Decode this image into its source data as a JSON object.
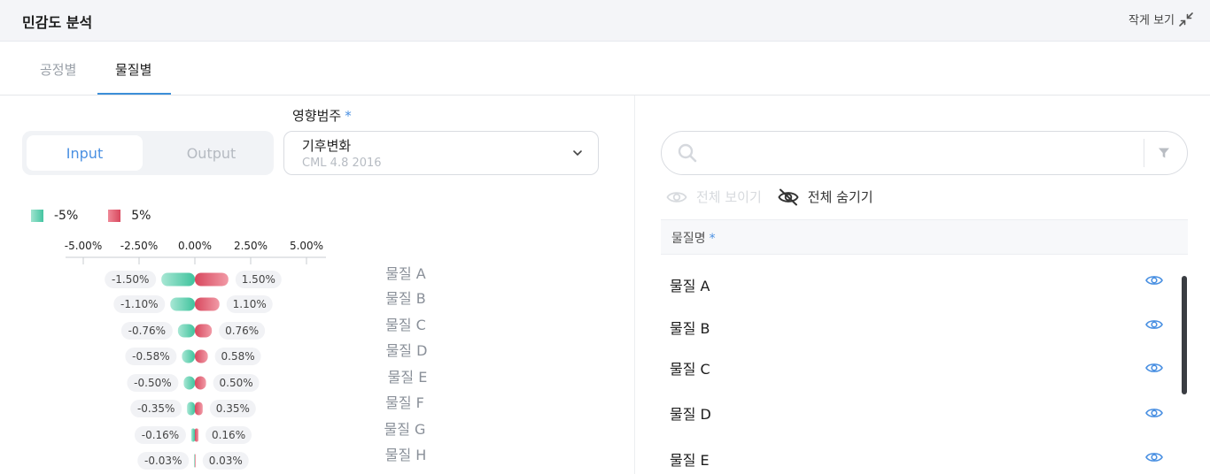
{
  "header": {
    "title": "민감도 분석",
    "collapse_label": "작게 보기"
  },
  "tabs": [
    {
      "label": "공정별",
      "active": false
    },
    {
      "label": "물질별",
      "active": true
    }
  ],
  "segment": {
    "input_label": "Input",
    "output_label": "Output",
    "selected": "Input"
  },
  "impact": {
    "label": "영향범주",
    "required_mark": "*",
    "selected_value": "기후변화",
    "selected_method": "CML 4.8 2016"
  },
  "legend": {
    "negative": "-5%",
    "positive": "5%"
  },
  "colors": {
    "accent": "#4a90e2",
    "negative_bar": "#44c5a1",
    "positive_bar": "#d8485e"
  },
  "chart_data": {
    "type": "bar",
    "orientation": "horizontal-tornado",
    "x_ticks": [
      "-5.00%",
      "-2.50%",
      "0.00%",
      "2.50%",
      "5.00%"
    ],
    "xlim": [
      -5,
      5
    ],
    "categories": [
      "물질 A",
      "물질 B",
      "물질 C",
      "물질 D",
      "물질 E",
      "물질 F",
      "물질 G",
      "물질 H"
    ],
    "series": [
      {
        "name": "-5%",
        "values": [
          -1.5,
          -1.1,
          -0.76,
          -0.58,
          -0.5,
          -0.35,
          -0.16,
          -0.03
        ]
      },
      {
        "name": "5%",
        "values": [
          1.5,
          1.1,
          0.76,
          0.58,
          0.5,
          0.35,
          0.16,
          0.03
        ]
      }
    ],
    "neg_labels": [
      "-1.50%",
      "-1.10%",
      "-0.76%",
      "-0.58%",
      "-0.50%",
      "-0.35%",
      "-0.16%",
      "-0.03%"
    ],
    "pos_labels": [
      "1.50%",
      "1.10%",
      "0.76%",
      "0.58%",
      "0.50%",
      "0.35%",
      "0.16%",
      "0.03%"
    ]
  },
  "search": {
    "placeholder": "",
    "value": ""
  },
  "visibility": {
    "show_all": "전체 보이기",
    "hide_all": "전체 숨기기"
  },
  "list": {
    "header": "물질명",
    "required_mark": "*",
    "items": [
      {
        "label": "물질 A",
        "icon": "eye-icon"
      },
      {
        "label": "물질 B",
        "icon": "eye-icon"
      },
      {
        "label": "물질 C",
        "icon": "eye-icon"
      },
      {
        "label": "물질 D",
        "icon": "eye-icon"
      },
      {
        "label": "물질 E",
        "icon": "eye-icon"
      }
    ]
  }
}
